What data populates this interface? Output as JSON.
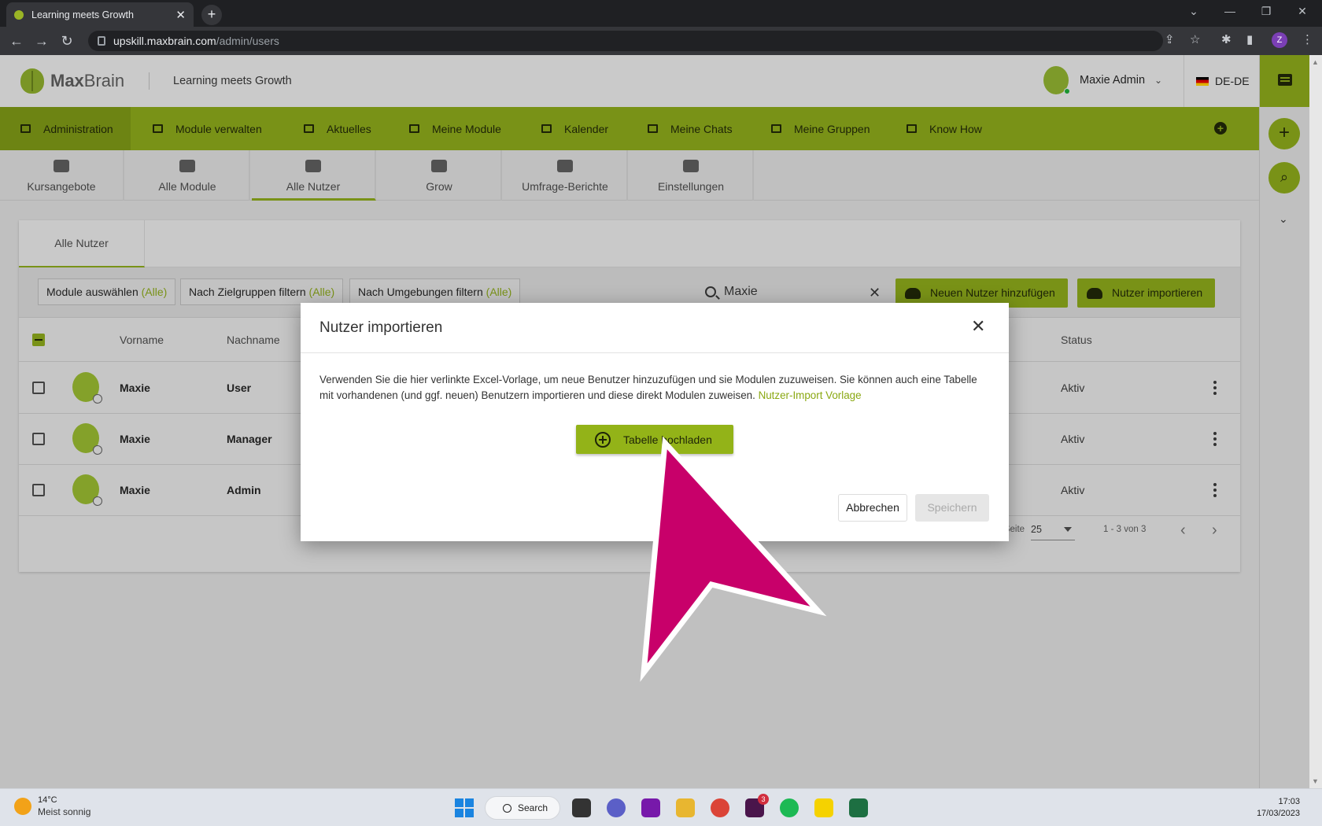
{
  "browser": {
    "tab_title": "Learning meets Growth",
    "url_host": "upskill.maxbrain.com",
    "url_path": "/admin/users",
    "profile_initial": "Z"
  },
  "header": {
    "logo_strong": "Max",
    "logo_light": "Brain",
    "tagline": "Learning meets Growth",
    "user_name": "Maxie Admin",
    "language": "DE-DE"
  },
  "nav": {
    "items": [
      "Administration",
      "Module verwalten",
      "Aktuelles",
      "Meine Module",
      "Kalender",
      "Meine Chats",
      "Meine Gruppen",
      "Know How"
    ]
  },
  "subnav": {
    "items": [
      "Kursangebote",
      "Alle Module",
      "Alle Nutzer",
      "Grow",
      "Umfrage-Berichte",
      "Einstellungen"
    ]
  },
  "card": {
    "tab": "Alle Nutzer",
    "filters": [
      {
        "label": "Module auswählen",
        "all": "(Alle)"
      },
      {
        "label": "Nach Zielgruppen filtern",
        "all": "(Alle)"
      },
      {
        "label": "Nach Umgebungen filtern",
        "all": "(Alle)"
      }
    ],
    "search_value": "Maxie",
    "add_user_label": "Neuen Nutzer hinzufügen",
    "import_label": "Nutzer importieren",
    "columns": {
      "first": "Vorname",
      "last": "Nachname",
      "status": "Status"
    },
    "rows": [
      {
        "first": "Maxie",
        "last": "User",
        "status": "Aktiv"
      },
      {
        "first": "Maxie",
        "last": "Manager",
        "status": "Aktiv"
      },
      {
        "first": "Maxie",
        "last": "Admin",
        "status": "Aktiv"
      }
    ],
    "pager": {
      "label": "Einträge pro Seite",
      "page_size": "25",
      "range": "1 - 3 von 3"
    }
  },
  "modal": {
    "title": "Nutzer importieren",
    "text": "Verwenden Sie die hier verlinkte Excel-Vorlage, um neue Benutzer hinzuzufügen und sie Modulen zuzuweisen. Sie können auch eine Tabelle mit vorhandenen (und ggf. neuen) Benutzern importieren und diese direkt Modulen zuweisen.",
    "link": "Nutzer-Import Vorlage",
    "upload_label": "Tabelle hochladen",
    "cancel_label": "Abbrechen",
    "save_label": "Speichern"
  },
  "taskbar": {
    "temp": "14°C",
    "weather": "Meist sonnig",
    "search_label": "Search",
    "time": "17:03",
    "date": "17/03/2023",
    "slack_badge": "3"
  },
  "colors": {
    "brand_green": "#7e9818",
    "pointer": "#c8006a"
  }
}
